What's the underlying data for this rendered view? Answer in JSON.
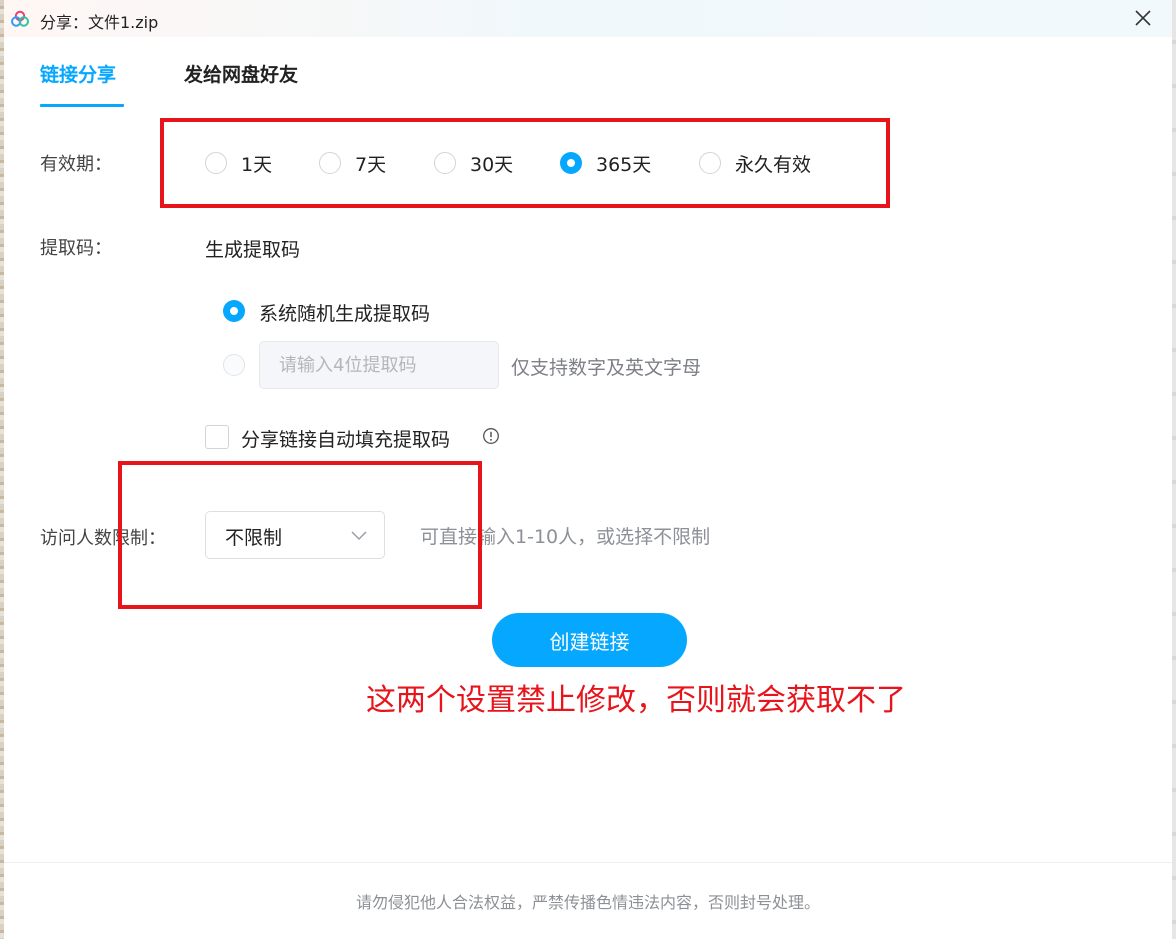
{
  "window": {
    "title": "分享：文件1.zip",
    "close_icon": "close-icon",
    "app_icon": "netdisk-logo-icon"
  },
  "tabs": [
    {
      "label": "链接分享",
      "active": true
    },
    {
      "label": "发给网盘好友",
      "active": false
    }
  ],
  "validity": {
    "label": "有效期：",
    "options": [
      {
        "label": "1天",
        "selected": false
      },
      {
        "label": "7天",
        "selected": false
      },
      {
        "label": "30天",
        "selected": false
      },
      {
        "label": "365天",
        "selected": true
      },
      {
        "label": "永久有效",
        "selected": false
      }
    ]
  },
  "extract_code": {
    "label": "提取码：",
    "heading": "生成提取码",
    "random_option": "系统随机生成提取码",
    "custom_placeholder": "请输入4位提取码",
    "custom_hint": "仅支持数字及英文字母",
    "autofill_label": "分享链接自动填充提取码",
    "autofill_checked": false,
    "info_icon": "info-circle-icon"
  },
  "visitor_limit": {
    "label": "访问人数限制：",
    "selected": "不限制",
    "hint": "可直接输入1-10人，或选择不限制",
    "dropdown_icon": "chevron-down-icon"
  },
  "create_button": "创建链接",
  "annotation": {
    "text": "这两个设置禁止修改，否则就会获取不了",
    "color": "#e8141b"
  },
  "footer": "请勿侵犯他人合法权益，严禁传播色情违法内容，否则封号处理。",
  "colors": {
    "accent": "#06a7ff",
    "annotation": "#e8141b"
  }
}
